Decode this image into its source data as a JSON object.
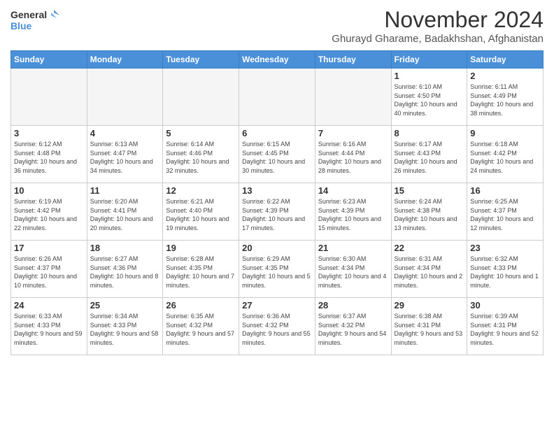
{
  "logo": {
    "line1": "General",
    "line2": "Blue"
  },
  "title": "November 2024",
  "subtitle": "Ghurayd Gharame, Badakhshan, Afghanistan",
  "days_of_week": [
    "Sunday",
    "Monday",
    "Tuesday",
    "Wednesday",
    "Thursday",
    "Friday",
    "Saturday"
  ],
  "weeks": [
    [
      {
        "day": "",
        "info": ""
      },
      {
        "day": "",
        "info": ""
      },
      {
        "day": "",
        "info": ""
      },
      {
        "day": "",
        "info": ""
      },
      {
        "day": "",
        "info": ""
      },
      {
        "day": "1",
        "info": "Sunrise: 6:10 AM\nSunset: 4:50 PM\nDaylight: 10 hours\nand 40 minutes."
      },
      {
        "day": "2",
        "info": "Sunrise: 6:11 AM\nSunset: 4:49 PM\nDaylight: 10 hours\nand 38 minutes."
      }
    ],
    [
      {
        "day": "3",
        "info": "Sunrise: 6:12 AM\nSunset: 4:48 PM\nDaylight: 10 hours\nand 36 minutes."
      },
      {
        "day": "4",
        "info": "Sunrise: 6:13 AM\nSunset: 4:47 PM\nDaylight: 10 hours\nand 34 minutes."
      },
      {
        "day": "5",
        "info": "Sunrise: 6:14 AM\nSunset: 4:46 PM\nDaylight: 10 hours\nand 32 minutes."
      },
      {
        "day": "6",
        "info": "Sunrise: 6:15 AM\nSunset: 4:45 PM\nDaylight: 10 hours\nand 30 minutes."
      },
      {
        "day": "7",
        "info": "Sunrise: 6:16 AM\nSunset: 4:44 PM\nDaylight: 10 hours\nand 28 minutes."
      },
      {
        "day": "8",
        "info": "Sunrise: 6:17 AM\nSunset: 4:43 PM\nDaylight: 10 hours\nand 26 minutes."
      },
      {
        "day": "9",
        "info": "Sunrise: 6:18 AM\nSunset: 4:42 PM\nDaylight: 10 hours\nand 24 minutes."
      }
    ],
    [
      {
        "day": "10",
        "info": "Sunrise: 6:19 AM\nSunset: 4:42 PM\nDaylight: 10 hours\nand 22 minutes."
      },
      {
        "day": "11",
        "info": "Sunrise: 6:20 AM\nSunset: 4:41 PM\nDaylight: 10 hours\nand 20 minutes."
      },
      {
        "day": "12",
        "info": "Sunrise: 6:21 AM\nSunset: 4:40 PM\nDaylight: 10 hours\nand 19 minutes."
      },
      {
        "day": "13",
        "info": "Sunrise: 6:22 AM\nSunset: 4:39 PM\nDaylight: 10 hours\nand 17 minutes."
      },
      {
        "day": "14",
        "info": "Sunrise: 6:23 AM\nSunset: 4:39 PM\nDaylight: 10 hours\nand 15 minutes."
      },
      {
        "day": "15",
        "info": "Sunrise: 6:24 AM\nSunset: 4:38 PM\nDaylight: 10 hours\nand 13 minutes."
      },
      {
        "day": "16",
        "info": "Sunrise: 6:25 AM\nSunset: 4:37 PM\nDaylight: 10 hours\nand 12 minutes."
      }
    ],
    [
      {
        "day": "17",
        "info": "Sunrise: 6:26 AM\nSunset: 4:37 PM\nDaylight: 10 hours\nand 10 minutes."
      },
      {
        "day": "18",
        "info": "Sunrise: 6:27 AM\nSunset: 4:36 PM\nDaylight: 10 hours\nand 8 minutes."
      },
      {
        "day": "19",
        "info": "Sunrise: 6:28 AM\nSunset: 4:35 PM\nDaylight: 10 hours\nand 7 minutes."
      },
      {
        "day": "20",
        "info": "Sunrise: 6:29 AM\nSunset: 4:35 PM\nDaylight: 10 hours\nand 5 minutes."
      },
      {
        "day": "21",
        "info": "Sunrise: 6:30 AM\nSunset: 4:34 PM\nDaylight: 10 hours\nand 4 minutes."
      },
      {
        "day": "22",
        "info": "Sunrise: 6:31 AM\nSunset: 4:34 PM\nDaylight: 10 hours\nand 2 minutes."
      },
      {
        "day": "23",
        "info": "Sunrise: 6:32 AM\nSunset: 4:33 PM\nDaylight: 10 hours\nand 1 minute."
      }
    ],
    [
      {
        "day": "24",
        "info": "Sunrise: 6:33 AM\nSunset: 4:33 PM\nDaylight: 9 hours\nand 59 minutes."
      },
      {
        "day": "25",
        "info": "Sunrise: 6:34 AM\nSunset: 4:33 PM\nDaylight: 9 hours\nand 58 minutes."
      },
      {
        "day": "26",
        "info": "Sunrise: 6:35 AM\nSunset: 4:32 PM\nDaylight: 9 hours\nand 57 minutes."
      },
      {
        "day": "27",
        "info": "Sunrise: 6:36 AM\nSunset: 4:32 PM\nDaylight: 9 hours\nand 55 minutes."
      },
      {
        "day": "28",
        "info": "Sunrise: 6:37 AM\nSunset: 4:32 PM\nDaylight: 9 hours\nand 54 minutes."
      },
      {
        "day": "29",
        "info": "Sunrise: 6:38 AM\nSunset: 4:31 PM\nDaylight: 9 hours\nand 53 minutes."
      },
      {
        "day": "30",
        "info": "Sunrise: 6:39 AM\nSunset: 4:31 PM\nDaylight: 9 hours\nand 52 minutes."
      }
    ]
  ]
}
